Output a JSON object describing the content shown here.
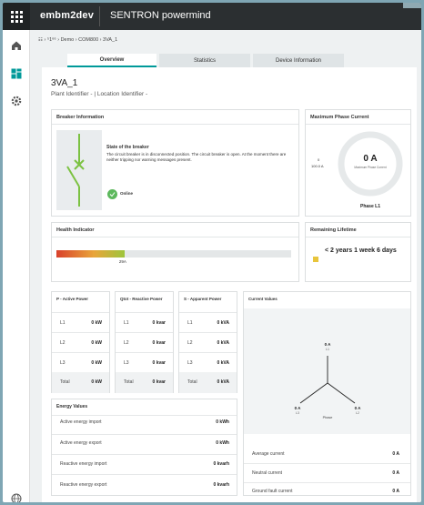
{
  "header": {
    "app_name": "embm2dev",
    "product": "SENTRON powermind"
  },
  "breadcrumb": {
    "text": "☷  ›  ⁵1⁶⁶  ›  Demo  ›  COM800  ›  3VA_1"
  },
  "tabs": [
    {
      "label": "Overview"
    },
    {
      "label": "Statistics"
    },
    {
      "label": "Device Information"
    }
  ],
  "device": {
    "name": "3VA_1",
    "subtitle": "Plant Identifier - | Location Identifier -"
  },
  "breaker": {
    "title": "Breaker Information",
    "state_title": "State of the breaker",
    "state_text": "The circuit breaker is in disconnected position. The circuit breaker is open. At the moment there are neither tripping nor warning messages present.",
    "status": "Online"
  },
  "max_phase": {
    "title": "Maximum Phase Current",
    "value": "0 A",
    "gauge_label": "Maximum Phase Current",
    "scale_min": "0",
    "scale_max": "100.0 A",
    "phase": "Phase L1",
    "fraction": 0
  },
  "health": {
    "title": "Health Indicator",
    "value_label": "29A",
    "fraction": 0.29
  },
  "lifetime": {
    "title": "Remaining Lifetime",
    "value": "< 2 years 1 week 6 days"
  },
  "active_power": {
    "title": "P - Active Power",
    "rows": [
      {
        "k": "L1",
        "v": "0 kW"
      },
      {
        "k": "L2",
        "v": "0 kW"
      },
      {
        "k": "L3",
        "v": "0 kW"
      },
      {
        "k": "Total",
        "v": "0 kW"
      }
    ]
  },
  "reactive_power": {
    "title": "Qtot - Reactive Power",
    "rows": [
      {
        "k": "L1",
        "v": "0 kvar"
      },
      {
        "k": "L2",
        "v": "0 kvar"
      },
      {
        "k": "L3",
        "v": "0 kvar"
      },
      {
        "k": "Total",
        "v": "0 kvar"
      }
    ]
  },
  "apparent_power": {
    "title": "S - Apparent Power",
    "rows": [
      {
        "k": "L1",
        "v": "0 kVA"
      },
      {
        "k": "L2",
        "v": "0 kVA"
      },
      {
        "k": "L3",
        "v": "0 kVA"
      },
      {
        "k": "Total",
        "v": "0 kVA"
      }
    ]
  },
  "current_values": {
    "title": "Current Values",
    "l1": {
      "value": "0 A",
      "label": "L1"
    },
    "l2": {
      "value": "0 A",
      "label": "L2"
    },
    "l3": {
      "value": "0 A",
      "label": "L3"
    },
    "phase_label": "Phase",
    "rows": [
      {
        "k": "Average current",
        "v": "0 A"
      },
      {
        "k": "Neutral current",
        "v": "0 A"
      },
      {
        "k": "Ground fault current",
        "v": "0 A"
      }
    ]
  },
  "energy": {
    "title": "Energy Values",
    "rows": [
      {
        "k": "Active energy import",
        "v": "0 kWh"
      },
      {
        "k": "Active energy export",
        "v": "0 kWh"
      },
      {
        "k": "Reactive energy import",
        "v": "0 kvarh"
      },
      {
        "k": "Reactive energy export",
        "v": "0 kvarh"
      }
    ]
  },
  "colors": {
    "accent": "#009999",
    "health_red": "#d9412b",
    "health_yellow": "#e9c53a",
    "health_green": "#7fc241",
    "lifetime_square": "#e8c53c"
  }
}
